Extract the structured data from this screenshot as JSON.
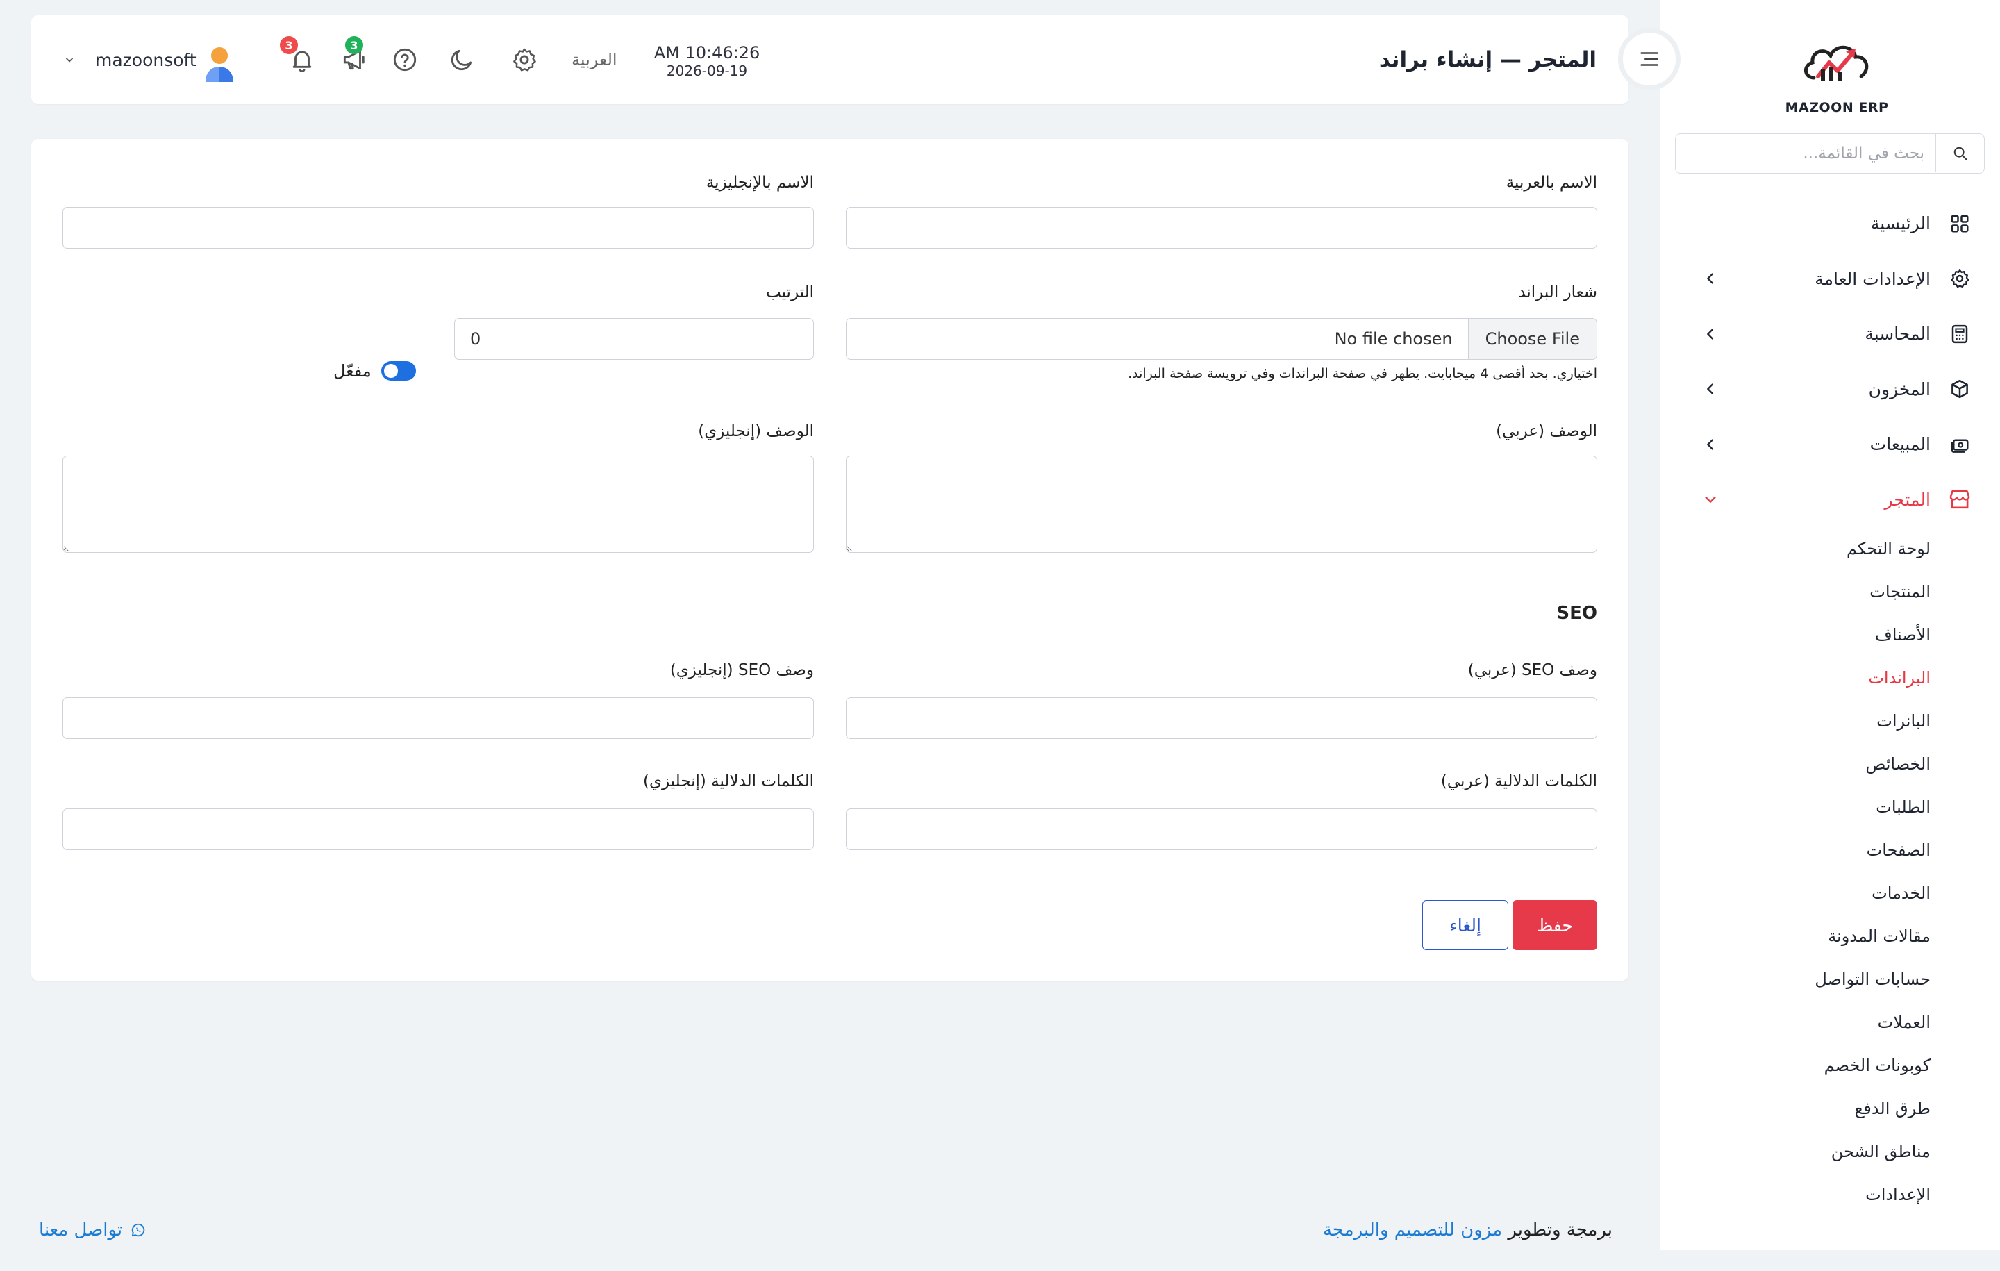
{
  "brand": {
    "logo_text": "MAZOON ERP",
    "logo_tag": "ERP-ERP"
  },
  "sidebar": {
    "search_placeholder": "بحث في القائمة...",
    "items": [
      {
        "label": "الرئيسية",
        "icon": "grid-icon",
        "has_children": false
      },
      {
        "label": "الإعدادات العامة",
        "icon": "gear-icon",
        "has_children": true
      },
      {
        "label": "المحاسبة",
        "icon": "calculator-icon",
        "has_children": true
      },
      {
        "label": "المخزون",
        "icon": "box-icon",
        "has_children": true
      },
      {
        "label": "المبيعات",
        "icon": "cash-icon",
        "has_children": true
      },
      {
        "label": "المتجر",
        "icon": "store-icon",
        "has_children": true,
        "active": true
      }
    ],
    "store_subitems": [
      "لوحة التحكم",
      "المنتجات",
      "الأصناف",
      "البراندات",
      "البانرات",
      "الخصائص",
      "الطلبات",
      "الصفحات",
      "الخدمات",
      "مقالات المدونة",
      "حسابات التواصل",
      "العملات",
      "كوبونات الخصم",
      "طرق الدفع",
      "مناطق الشحن",
      "الإعدادات"
    ],
    "active_subitem": "البراندات"
  },
  "header": {
    "title": "المتجر — إنشاء براند",
    "time": "AM 10:46:26",
    "date": "2026-09-19",
    "language": "العربية",
    "username": "mazoonsoft",
    "notifications_count": "3",
    "announcements_count": "3"
  },
  "form": {
    "name_ar_label": "الاسم بالعربية",
    "name_en_label": "الاسم بالإنجليزية",
    "name_ar_value": "",
    "name_en_value": "",
    "logo_label": "شعار البراند",
    "file_button": "Choose File",
    "file_status": "No file chosen",
    "logo_hint": "اختياري. بحد أقصى 4 ميجابايت. يظهر في صفحة البراندات وفي ترويسة صفحة البراند.",
    "order_label": "الترتيب",
    "order_value": "0",
    "enabled_label": "مفعّل",
    "desc_ar_label": "الوصف (عربي)",
    "desc_en_label": "الوصف (إنجليزي)",
    "seo_title": "SEO",
    "seo_desc_ar_label": "وصف SEO (عربي)",
    "seo_desc_en_label": "وصف SEO (إنجليزي)",
    "keywords_ar_label": "الكلمات الدلالية (عربي)",
    "keywords_en_label": "الكلمات الدلالية (إنجليزي)",
    "save_label": "حفظ",
    "cancel_label": "إلغاء"
  },
  "footer": {
    "credit_prefix": "برمجة وتطوير",
    "credit_link": "مزون للتصميم والبرمجة",
    "contact_label": "تواصل معنا"
  },
  "colors": {
    "accent": "#e63a4a",
    "link": "#1b7bd2",
    "primary": "#2b57c9",
    "toggle": "#1e6fe0"
  }
}
